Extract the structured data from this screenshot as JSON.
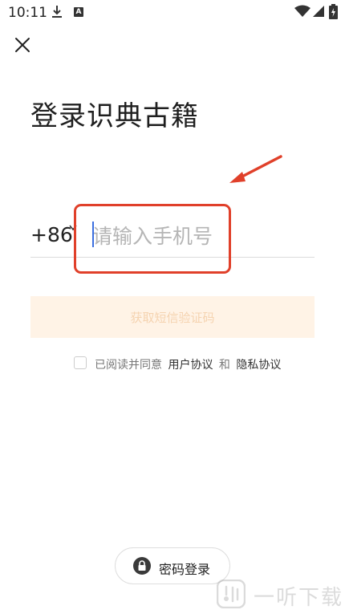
{
  "status_bar": {
    "time": "10:11",
    "icons": [
      "download-icon",
      "a-badge-icon",
      "wifi-icon",
      "signal-icon",
      "battery-icon"
    ],
    "a_badge": "A"
  },
  "header": {
    "close_icon": "close-icon"
  },
  "title": "登录识典古籍",
  "phone": {
    "country_code": "+86",
    "chevron_icon": "chevron-down-icon",
    "placeholder": "请输入手机号",
    "value": ""
  },
  "sms_button": {
    "label": "获取短信验证码"
  },
  "agreement": {
    "prefix": "已阅读并同意",
    "user_agreement": "用户协议",
    "conjunction": "和",
    "privacy_policy": "隐私协议",
    "checked": false
  },
  "password_login": {
    "label": "密码登录",
    "icon": "lock-icon"
  },
  "watermark": {
    "text": "一听下载"
  },
  "colors": {
    "accent_red": "#e0402a",
    "sms_button_bg": "#fff3e6",
    "sms_button_text": "#f5d3b0",
    "caret": "#3b6fe0"
  }
}
